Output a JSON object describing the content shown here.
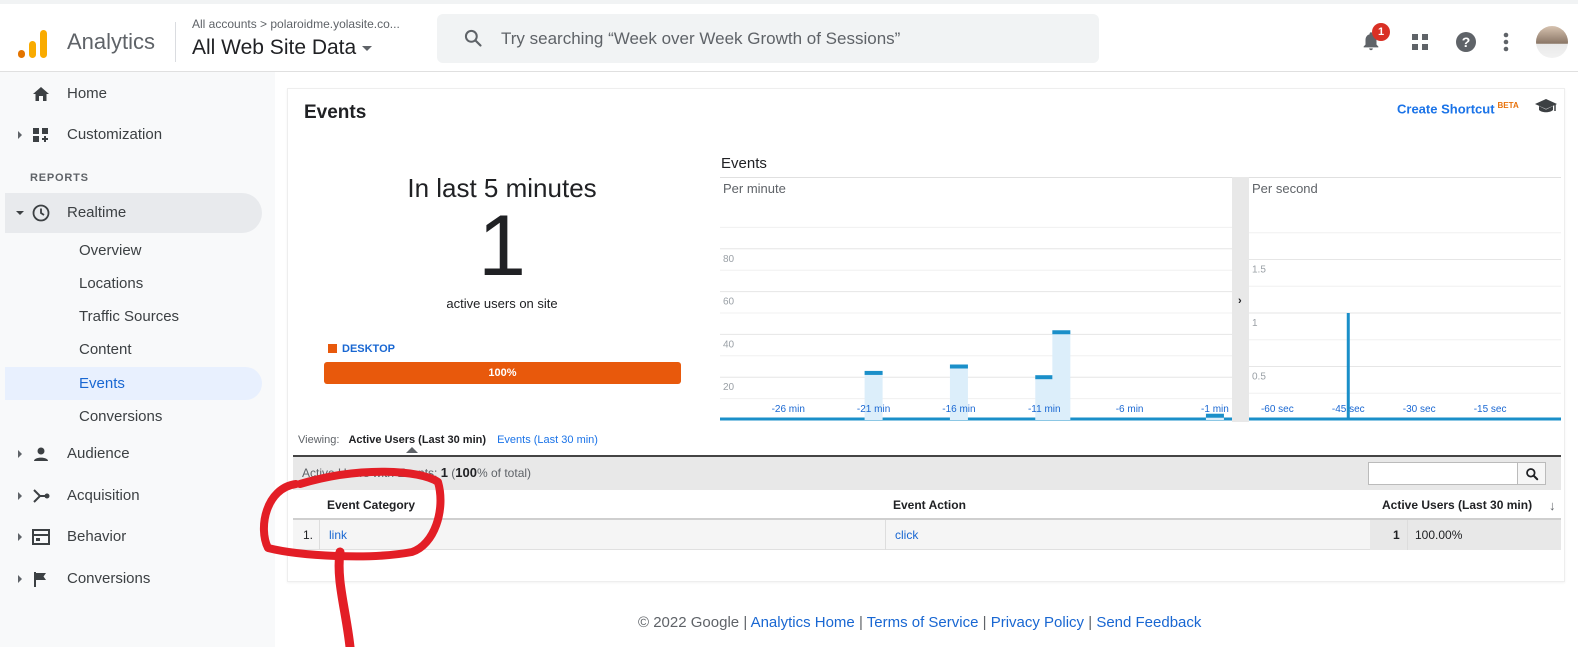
{
  "header": {
    "app_name": "Analytics",
    "breadcrumb": "All accounts > polaroidme.yolasite.co...",
    "view_name": "All Web Site Data",
    "search_placeholder": "Try searching “Week over Week Growth of Sessions”",
    "notification_count": "1",
    "icons": [
      "notifications-bell-icon",
      "apps-grid-icon",
      "help-icon",
      "more-vert-icon"
    ]
  },
  "sidebar": {
    "home": "Home",
    "customization": "Customization",
    "reports_section": "REPORTS",
    "realtime": "Realtime",
    "realtime_items": [
      "Overview",
      "Locations",
      "Traffic Sources",
      "Content",
      "Events",
      "Conversions"
    ],
    "active_item": "Events",
    "audience": "Audience",
    "acquisition": "Acquisition",
    "behavior": "Behavior",
    "conversions": "Conversions"
  },
  "main": {
    "title": "Events",
    "create_shortcut": "Create Shortcut",
    "beta": "BETA",
    "in_last": "In last 5 minutes",
    "active_users": "1",
    "active_users_label": "active users on site",
    "device_legend": "DESKTOP",
    "device_percent": "100%",
    "device_share": 1.0,
    "events_heading": "Events",
    "viewing_label": "Viewing:",
    "viewing_active": "Active Users (Last 30 min)",
    "viewing_other": "Events (Last 30 min)",
    "summary_prefix": "Active Users with Events:",
    "summary_count": "1",
    "summary_pct": "100",
    "summary_suffix": "% of total)",
    "table": {
      "headers": [
        "Event Category",
        "Event Action",
        "Active Users (Last 30 min)"
      ],
      "rows": [
        {
          "index": "1.",
          "category": "link",
          "action": "click",
          "users": "1",
          "pct": "100.00%"
        }
      ]
    }
  },
  "chart_data": [
    {
      "type": "bar",
      "title": "Per minute",
      "y_ticks": [
        "80",
        "60",
        "40",
        "20"
      ],
      "ylim": [
        0,
        100
      ],
      "x_ticks": [
        "-26 min",
        "-21 min",
        "-16 min",
        "-11 min",
        "-6 min",
        "-1 min"
      ],
      "x_tick_values": [
        -26,
        -21,
        -16,
        -11,
        -6,
        -1
      ],
      "xlim": [
        -30,
        0
      ],
      "x": [
        -21,
        -16,
        -11,
        -10,
        -1
      ],
      "values": [
        22,
        25,
        20,
        41,
        2
      ],
      "grid": true,
      "colors": {
        "bar": "#1a8fc9",
        "bar_fill": "#dceefa"
      }
    },
    {
      "type": "bar",
      "title": "Per second",
      "y_ticks": [
        "1.5",
        "1",
        "0.5"
      ],
      "ylim": [
        0,
        2
      ],
      "x_ticks": [
        "-60 sec",
        "-45 sec",
        "-30 sec",
        "-15 sec"
      ],
      "x_tick_values": [
        -60,
        -45,
        -30,
        -15
      ],
      "xlim": [
        -66,
        0
      ],
      "x": [
        -45
      ],
      "values": [
        1
      ],
      "grid": true,
      "colors": {
        "bar": "#1a8fc9"
      }
    }
  ],
  "footer": {
    "copyright": "© 2022 Google",
    "links": [
      "Analytics Home",
      "Terms of Service",
      "Privacy Policy",
      "Send Feedback"
    ],
    "separator": "|"
  },
  "colors": {
    "accent": "#1a73e8",
    "device": "#e8590c",
    "badge": "#d93025",
    "annotation": "#e31e26"
  }
}
